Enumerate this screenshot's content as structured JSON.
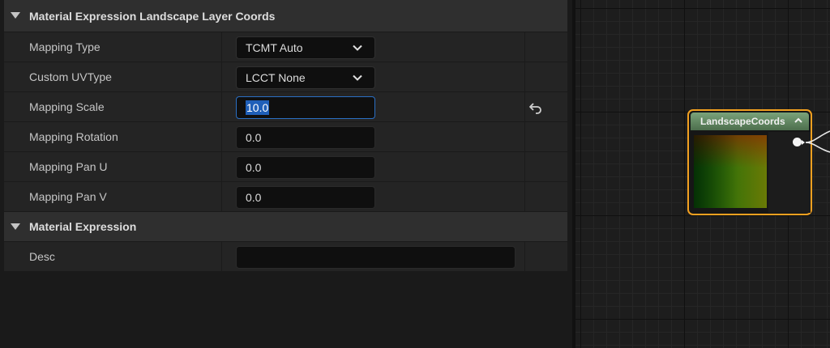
{
  "details": {
    "categories": [
      {
        "title": "Material Expression Landscape Layer Coords",
        "rows": [
          {
            "label": "Mapping Type",
            "value": "TCMT Auto",
            "kind": "combo"
          },
          {
            "label": "Custom UVType",
            "value": "LCCT None",
            "kind": "combo"
          },
          {
            "label": "Mapping Scale",
            "value": "10.0",
            "kind": "number",
            "focused": true,
            "reset": true
          },
          {
            "label": "Mapping Rotation",
            "value": "0.0",
            "kind": "number"
          },
          {
            "label": "Mapping Pan U",
            "value": "0.0",
            "kind": "number"
          },
          {
            "label": "Mapping Pan V",
            "value": "0.0",
            "kind": "number"
          }
        ]
      },
      {
        "title": "Material Expression",
        "rows": [
          {
            "label": "Desc",
            "value": "",
            "kind": "text"
          }
        ]
      }
    ]
  },
  "graph": {
    "node": {
      "title": "LandscapeCoords",
      "border_color": "#f2a020",
      "header_color": "#6e966e"
    }
  },
  "icons": {
    "expand": "triangle-down-icon",
    "dropdown": "chevron-down-icon",
    "reset": "reset-to-default-icon",
    "collapse": "chevron-up-icon",
    "output_pin": "output-pin-icon"
  }
}
